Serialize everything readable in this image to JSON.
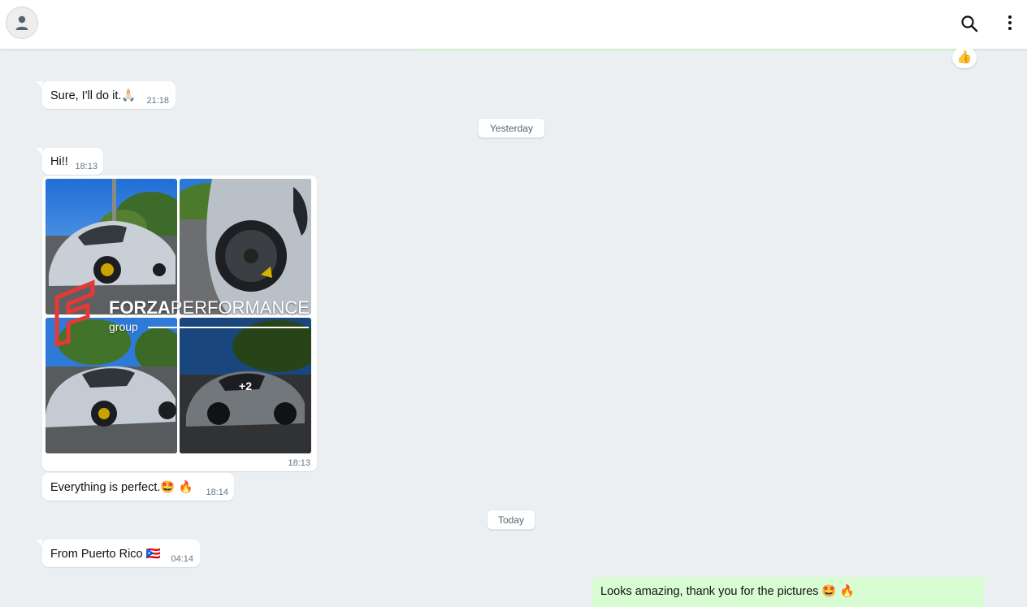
{
  "header": {
    "avatar_icon": "person-icon",
    "search_icon": "search-icon",
    "menu_icon": "kebab-menu-icon"
  },
  "top_reaction": {
    "emoji": "👍"
  },
  "messages": [
    {
      "text": "Sure, I'll do it.🙏🏻",
      "time": "21:18",
      "dir": "in"
    },
    {
      "text": "Hi!!",
      "time": "18:13",
      "dir": "in"
    },
    {
      "text": "Everything is perfect.🤩 🔥",
      "time": "18:14",
      "dir": "in"
    },
    {
      "text": "From Puerto Rico 🇵🇷",
      "time": "04:14",
      "dir": "in"
    },
    {
      "text": "Looks amazing, thank you for the pictures 🤩 🔥",
      "time": "",
      "dir": "out"
    }
  ],
  "dates": {
    "yesterday": "Yesterday",
    "today": "Today"
  },
  "media": {
    "time": "18:13",
    "more_count": "+2",
    "watermark_brand": "FORZA",
    "watermark_brand2": "PERFORMANCE",
    "watermark_sub": "group"
  },
  "colors": {
    "background": "#eceff1",
    "incoming_bubble": "#ffffff",
    "outgoing_bubble": "#d9fdd3",
    "time_text": "#667781",
    "watermark_red": "#e53935"
  }
}
